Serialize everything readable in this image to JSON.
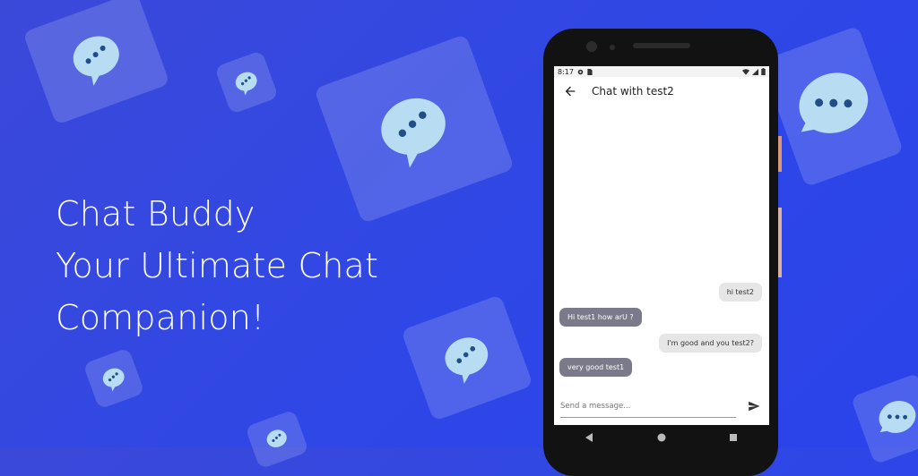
{
  "headline": {
    "line1": "Chat Buddy",
    "line2": "Your Ultimate Chat",
    "line3": "Companion!"
  },
  "colors": {
    "background": "#2f47e6",
    "bubble": "#b8dcf2",
    "dots": "#1f4f86",
    "incoming_bubble": "#7b7a8a",
    "outgoing_bubble": "#e6e6e6"
  },
  "phone": {
    "status_time": "8:17",
    "status_icons": [
      "settings-icon",
      "sim-icon",
      "wifi-icon",
      "signal-icon",
      "battery-icon"
    ],
    "app_title": "Chat with test2",
    "messages": [
      {
        "direction": "out",
        "text": "hi test2"
      },
      {
        "direction": "in",
        "text": "Hi test1 how arU ?"
      },
      {
        "direction": "out",
        "text": "I'm good and you test2?"
      },
      {
        "direction": "in",
        "text": "very good test1"
      }
    ],
    "composer_placeholder": "Send a message..."
  }
}
